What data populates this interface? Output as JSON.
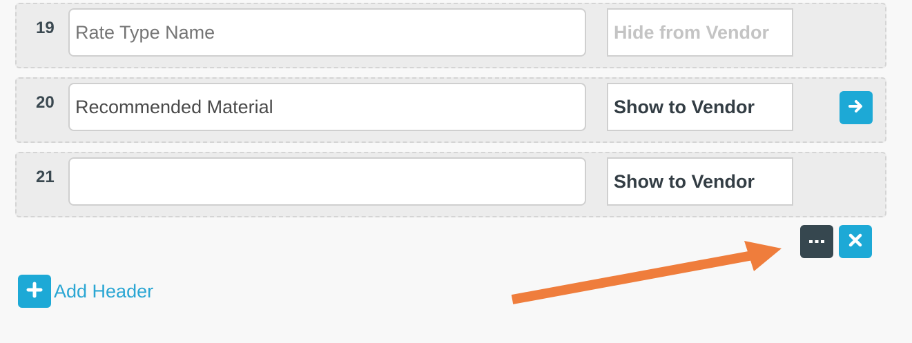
{
  "rows": [
    {
      "number": "19",
      "name_value": "",
      "name_placeholder": "Rate Type Name",
      "visibility": "Hide from Vendor",
      "visibility_muted": true
    },
    {
      "number": "20",
      "name_value": "Recommended Material",
      "name_placeholder": "",
      "visibility": "Show to Vendor",
      "visibility_muted": false
    },
    {
      "number": "21",
      "name_value": "",
      "name_placeholder": "",
      "visibility": "Show to Vendor",
      "visibility_muted": false
    }
  ],
  "add_header": {
    "label": "Add Header"
  },
  "icons": {
    "row_action": "arrow-right-icon",
    "more": "ellipsis-icon",
    "remove": "close-icon",
    "add": "plus-icon",
    "annotation": "orange-arrow"
  },
  "colors": {
    "accent": "#1da9d6",
    "dark_button": "#36474f",
    "annotation_arrow": "#ef7d3c"
  }
}
